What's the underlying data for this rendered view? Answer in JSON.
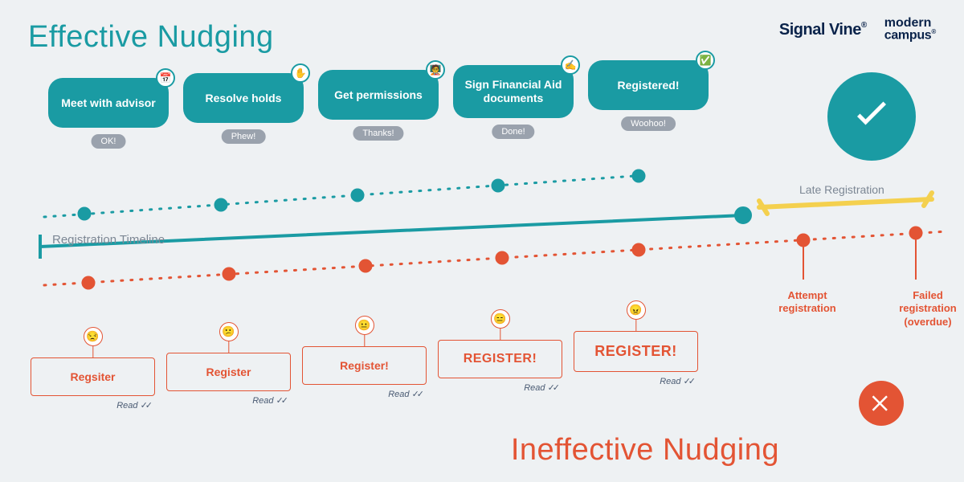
{
  "titles": {
    "effective": "Effective Nudging",
    "ineffective": "Ineffective Nudging"
  },
  "logos": {
    "signalvine": "Signal Vine",
    "moderncampus_l1": "modern",
    "moderncampus_l2": "campus"
  },
  "timeline": {
    "registration_label": "Registration Timeline",
    "late_label": "Late Registration"
  },
  "effective_nudges": [
    {
      "label": "Meet with advisor",
      "response": "OK!",
      "icon": "📅"
    },
    {
      "label": "Resolve holds",
      "response": "Phew!",
      "icon": "✋"
    },
    {
      "label": "Get permissions",
      "response": "Thanks!",
      "icon": "🧑‍🏫"
    },
    {
      "label": "Sign Financial Aid documents",
      "response": "Done!",
      "icon": "✍️"
    },
    {
      "label": "Registered!",
      "response": "Woohoo!",
      "icon": "✅"
    }
  ],
  "ineffective_nudges": [
    {
      "label": "Regsiter",
      "response": "Read",
      "emoji": "😒"
    },
    {
      "label": "Register",
      "response": "Read",
      "emoji": "😕"
    },
    {
      "label": "Register!",
      "response": "Read",
      "emoji": "😐"
    },
    {
      "label": "REGISTER!",
      "response": "Read",
      "emoji": "😑"
    },
    {
      "label": "REGISTER!",
      "response": "Read",
      "emoji": "😠"
    }
  ],
  "late_events": {
    "attempt": "Attempt registration",
    "failed": "Failed registration (overdue)"
  },
  "colors": {
    "teal": "#1a9ba3",
    "orange": "#e35434",
    "yellow": "#f4d04e",
    "grey": "#9aa2ad",
    "navy": "#0a234a"
  }
}
